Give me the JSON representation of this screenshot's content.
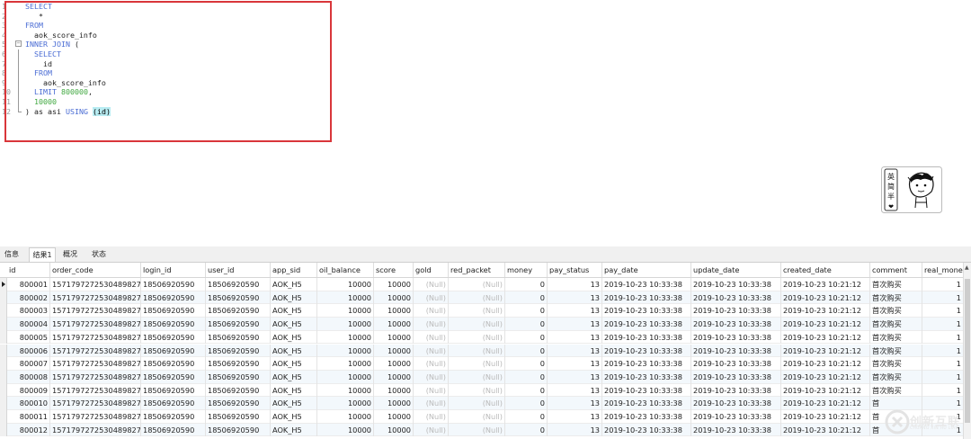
{
  "editor": {
    "lines": [
      {
        "n": "1",
        "parts": [
          {
            "t": "SELECT",
            "cls": "kw"
          }
        ]
      },
      {
        "n": "2",
        "parts": [
          {
            "t": "   *",
            "cls": "plain"
          }
        ]
      },
      {
        "n": "3",
        "parts": [
          {
            "t": "FROM",
            "cls": "kw"
          }
        ]
      },
      {
        "n": "4",
        "parts": [
          {
            "t": "  aok_score_info",
            "cls": "plain"
          }
        ]
      },
      {
        "n": "5",
        "parts": [
          {
            "t": "INNER JOIN",
            "cls": "kw"
          },
          {
            "t": " (",
            "cls": "plain"
          }
        ]
      },
      {
        "n": "6",
        "parts": [
          {
            "t": "  SELECT",
            "cls": "kw"
          }
        ]
      },
      {
        "n": "7",
        "parts": [
          {
            "t": "    id",
            "cls": "plain"
          }
        ]
      },
      {
        "n": "8",
        "parts": [
          {
            "t": "  FROM",
            "cls": "kw"
          }
        ]
      },
      {
        "n": "9",
        "parts": [
          {
            "t": "    aok_score_info",
            "cls": "plain"
          }
        ]
      },
      {
        "n": "10",
        "parts": [
          {
            "t": "  LIMIT ",
            "cls": "kw"
          },
          {
            "t": "800000",
            "cls": "num"
          },
          {
            "t": ",",
            "cls": "plain"
          }
        ]
      },
      {
        "n": "11",
        "parts": [
          {
            "t": "  10000",
            "cls": "num"
          }
        ]
      },
      {
        "n": "12",
        "parts": [
          {
            "t": ") as asi ",
            "cls": "plain"
          },
          {
            "t": "USING",
            "cls": "kw"
          },
          {
            "t": " ",
            "cls": "plain"
          },
          {
            "t": "(id)",
            "cls": "hl"
          }
        ]
      }
    ]
  },
  "logo": {
    "chars": [
      "英",
      "简",
      "半",
      "❤"
    ]
  },
  "tabs": [
    {
      "label": "信息",
      "active": false
    },
    {
      "label": "结果1",
      "active": true
    },
    {
      "label": "概况",
      "active": false
    },
    {
      "label": "状态",
      "active": false
    }
  ],
  "grid": {
    "columns": [
      "id",
      "order_code",
      "login_id",
      "user_id",
      "app_sid",
      "oil_balance",
      "score",
      "gold",
      "red_packet",
      "money",
      "pay_status",
      "pay_date",
      "update_date",
      "created_date",
      "comment",
      "real_mone"
    ],
    "rows": [
      [
        "800001",
        "1571797272530489827",
        "18506920590",
        "18506920590",
        "AOK_H5",
        "10000",
        "10000",
        "(Null)",
        "(Null)",
        "0",
        "13",
        "2019-10-23 10:33:38",
        "2019-10-23 10:33:38",
        "2019-10-23 10:21:12",
        "首次购买",
        "1"
      ],
      [
        "800002",
        "1571797272530489827",
        "18506920590",
        "18506920590",
        "AOK_H5",
        "10000",
        "10000",
        "(Null)",
        "(Null)",
        "0",
        "13",
        "2019-10-23 10:33:38",
        "2019-10-23 10:33:38",
        "2019-10-23 10:21:12",
        "首次购买",
        "1"
      ],
      [
        "800003",
        "1571797272530489827",
        "18506920590",
        "18506920590",
        "AOK_H5",
        "10000",
        "10000",
        "(Null)",
        "(Null)",
        "0",
        "13",
        "2019-10-23 10:33:38",
        "2019-10-23 10:33:38",
        "2019-10-23 10:21:12",
        "首次购买",
        "1"
      ],
      [
        "800004",
        "1571797272530489827",
        "18506920590",
        "18506920590",
        "AOK_H5",
        "10000",
        "10000",
        "(Null)",
        "(Null)",
        "0",
        "13",
        "2019-10-23 10:33:38",
        "2019-10-23 10:33:38",
        "2019-10-23 10:21:12",
        "首次购买",
        "1"
      ],
      [
        "800005",
        "1571797272530489827",
        "18506920590",
        "18506920590",
        "AOK_H5",
        "10000",
        "10000",
        "(Null)",
        "(Null)",
        "0",
        "13",
        "2019-10-23 10:33:38",
        "2019-10-23 10:33:38",
        "2019-10-23 10:21:12",
        "首次购买",
        "1"
      ],
      [
        "800006",
        "1571797272530489827",
        "18506920590",
        "18506920590",
        "AOK_H5",
        "10000",
        "10000",
        "(Null)",
        "(Null)",
        "0",
        "13",
        "2019-10-23 10:33:38",
        "2019-10-23 10:33:38",
        "2019-10-23 10:21:12",
        "首次购买",
        "1"
      ],
      [
        "800007",
        "1571797272530489827",
        "18506920590",
        "18506920590",
        "AOK_H5",
        "10000",
        "10000",
        "(Null)",
        "(Null)",
        "0",
        "13",
        "2019-10-23 10:33:38",
        "2019-10-23 10:33:38",
        "2019-10-23 10:21:12",
        "首次购买",
        "1"
      ],
      [
        "800008",
        "1571797272530489827",
        "18506920590",
        "18506920590",
        "AOK_H5",
        "10000",
        "10000",
        "(Null)",
        "(Null)",
        "0",
        "13",
        "2019-10-23 10:33:38",
        "2019-10-23 10:33:38",
        "2019-10-23 10:21:12",
        "首次购买",
        "1"
      ],
      [
        "800009",
        "1571797272530489827",
        "18506920590",
        "18506920590",
        "AOK_H5",
        "10000",
        "10000",
        "(Null)",
        "(Null)",
        "0",
        "13",
        "2019-10-23 10:33:38",
        "2019-10-23 10:33:38",
        "2019-10-23 10:21:12",
        "首次购买",
        "1"
      ],
      [
        "800010",
        "1571797272530489827",
        "18506920590",
        "18506920590",
        "AOK_H5",
        "10000",
        "10000",
        "(Null)",
        "(Null)",
        "0",
        "13",
        "2019-10-23 10:33:38",
        "2019-10-23 10:33:38",
        "2019-10-23 10:21:12",
        "首",
        "1"
      ],
      [
        "800011",
        "1571797272530489827",
        "18506920590",
        "18506920590",
        "AOK_H5",
        "10000",
        "10000",
        "(Null)",
        "(Null)",
        "0",
        "13",
        "2019-10-23 10:33:38",
        "2019-10-23 10:33:38",
        "2019-10-23 10:21:12",
        "首",
        "1"
      ],
      [
        "800012",
        "1571797272530489827",
        "18506920590",
        "18506920590",
        "AOK_H5",
        "10000",
        "10000",
        "(Null)",
        "(Null)",
        "0",
        "13",
        "2019-10-23 10:33:38",
        "2019-10-23 10:33:38",
        "2019-10-23 10:21:12",
        "首",
        "1"
      ]
    ],
    "selected_row": 0
  },
  "watermark": {
    "text": "创新互联",
    "sub": "CHUANG XIN HU LIAN"
  },
  "colors": {
    "keyword": "#4a6cd4",
    "number": "#3fa83f",
    "highlight_box": "#d9363a",
    "alt_row": "#f3f8fc"
  }
}
